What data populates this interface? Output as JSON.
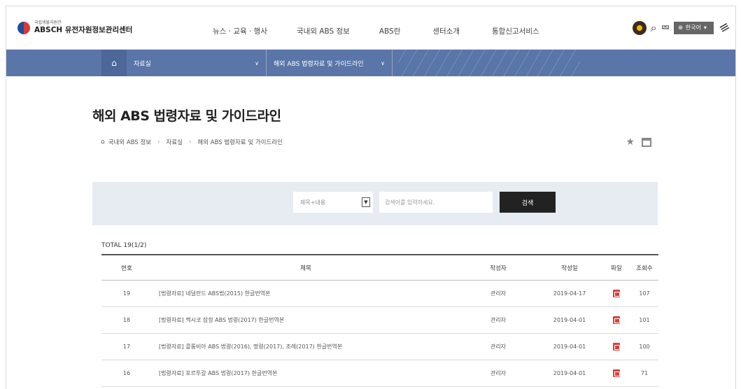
{
  "header": {
    "logo_small": "국립생물자원관",
    "logo_main": "ABSCH 유전자원정보관리센터",
    "nav": [
      "뉴스 · 교육 · 행사",
      "국내외 ABS 정보",
      "ABS란",
      "센터소개",
      "통합신고서비스"
    ],
    "lang": "한국어"
  },
  "location_bar": {
    "menu1": "자료실",
    "menu2": "해외 ABS 법령자료 및 가이드라인"
  },
  "page": {
    "title": "해외 ABS 법령자료 및 가이드라인",
    "breadcrumb": [
      "국내외 ABS 정보",
      "자료실",
      "해외 ABS 법령자료 및 가이드라인"
    ]
  },
  "search": {
    "select_value": "제목+내용",
    "placeholder": "검색어를 입력하세요.",
    "button": "검색"
  },
  "total": "TOTAL 19(1/2)",
  "table": {
    "headers": {
      "no": "번호",
      "title": "제목",
      "writer": "작성자",
      "date": "작성일",
      "file": "파일",
      "views": "조회수"
    },
    "rows": [
      {
        "no": "19",
        "title": "[법령자료] 네덜란드 ABS법(2015) 한글번역본",
        "writer": "관리자",
        "date": "2019-04-17",
        "views": "107"
      },
      {
        "no": "18",
        "title": "[법령자료] 멕시코 잠정 ABS 법령(2017) 한글번역본",
        "writer": "관리자",
        "date": "2019-04-01",
        "views": "101"
      },
      {
        "no": "17",
        "title": "[법령자료] 콜롬비아 ABS 법령(2016), 명령(2017), 조례(2017) 한글번역본",
        "writer": "관리자",
        "date": "2019-04-01",
        "views": "100"
      },
      {
        "no": "16",
        "title": "[법령자료] 포르투갈 ABS 법령(2017) 한글번역본",
        "writer": "관리자",
        "date": "2019-04-01",
        "views": "71"
      }
    ]
  },
  "colors": {
    "location_bar": "#5a75a8",
    "search_bg": "#e6ecf1",
    "search_button": "#222222",
    "pdf_icon": "#d9413a"
  }
}
